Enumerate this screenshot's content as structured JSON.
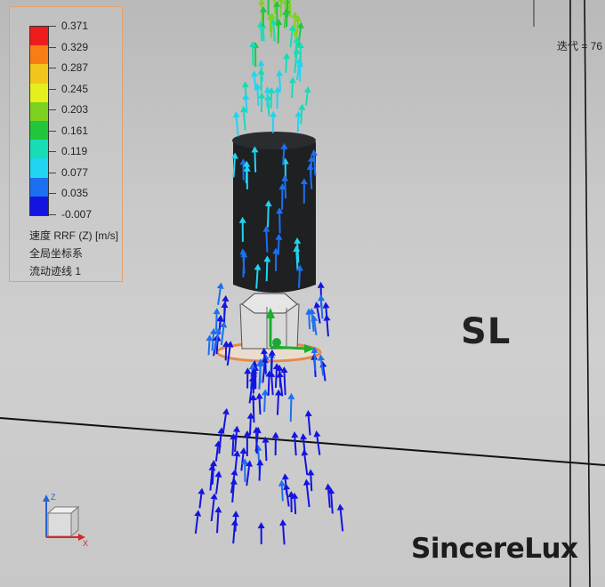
{
  "legend": {
    "values": [
      "0.371",
      "0.329",
      "0.287",
      "0.245",
      "0.203",
      "0.161",
      "0.119",
      "0.077",
      "0.035",
      "-0.007"
    ],
    "colors": [
      "#ee1c1c",
      "#f77d14",
      "#f2c51c",
      "#e6ef1e",
      "#7cd21e",
      "#22c63c",
      "#18dcb4",
      "#20d4f2",
      "#1c6ff0",
      "#1414e2"
    ],
    "quantity": "速度 RRF (Z) [m/s]",
    "coord_system": "全局坐标系",
    "trace": "流动迹线 1"
  },
  "iteration_label": "迭代 = 76",
  "watermark": "SL",
  "brand": "SincereLux",
  "triad": {
    "z_label": "Z",
    "x_label": "X"
  },
  "colors": {
    "background": "#c6c6c6",
    "cylinder": "#1e2022",
    "hub": "#d8d8d8",
    "flange": "#e48a4a"
  }
}
